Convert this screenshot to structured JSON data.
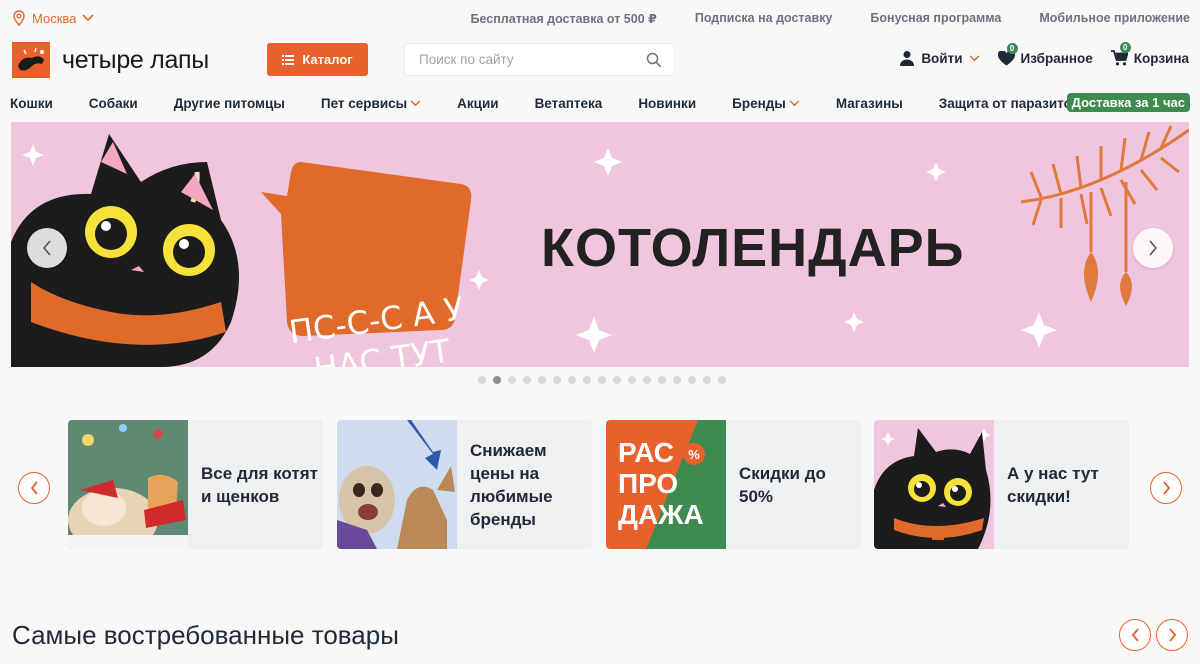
{
  "topbar": {
    "city": "Москва",
    "links": [
      "Бесплатная доставка от 500 ₽",
      "Подписка на доставку",
      "Бонусная программа",
      "Мобильное приложение"
    ]
  },
  "header": {
    "logo_text": "четыре лапы",
    "catalog_label": "Каталог",
    "search_placeholder": "Поиск по сайту",
    "login_label": "Войти",
    "favorites_label": "Избранное",
    "favorites_count": "0",
    "cart_label": "Корзина",
    "cart_count": "0"
  },
  "nav": {
    "items": [
      "Кошки",
      "Собаки",
      "Другие питомцы",
      "Пет сервисы",
      "Акции",
      "Ветаптека",
      "Новинки",
      "Бренды",
      "Магазины",
      "Защита от паразитов"
    ],
    "express": "Доставка за 1 час"
  },
  "banner": {
    "title": "КОТОЛЕНДАРЬ",
    "bubble_text": "ПС-С-С А У НАС ТУТ СКИДКИ!",
    "slide_count": 17,
    "active_slide": 2
  },
  "promos": [
    {
      "text": "Все для котят и щенков",
      "icon": "kitten-puppy-photo"
    },
    {
      "text": "Снижаем цены на любимые бренды",
      "icon": "dog-cat-photo"
    },
    {
      "text": "Скидки до 50%",
      "icon": "sale-graphic"
    },
    {
      "text": "А у нас тут скидки!",
      "icon": "black-cat-illustration"
    }
  ],
  "promo_sale_graphic_text": "РАС ПРО ДАЖА",
  "section": {
    "title": "Самые востребованные товары"
  },
  "colors": {
    "accent": "#e8612c",
    "green": "#3f8a4f",
    "banner_bg": "#f0c6de"
  }
}
